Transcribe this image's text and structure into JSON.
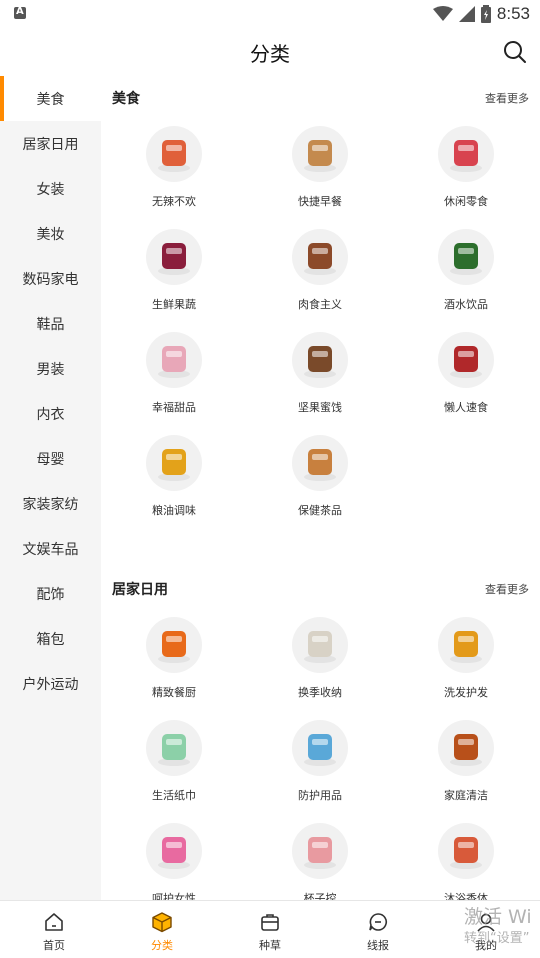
{
  "status_bar": {
    "time": "8:53"
  },
  "header": {
    "title": "分类"
  },
  "sidebar": {
    "items": [
      {
        "label": "美食",
        "active": true
      },
      {
        "label": "居家日用"
      },
      {
        "label": "女装"
      },
      {
        "label": "美妆"
      },
      {
        "label": "数码家电"
      },
      {
        "label": "鞋品"
      },
      {
        "label": "男装"
      },
      {
        "label": "内衣"
      },
      {
        "label": "母婴"
      },
      {
        "label": "家装家纺"
      },
      {
        "label": "文娱车品"
      },
      {
        "label": "配饰"
      },
      {
        "label": "箱包"
      },
      {
        "label": "户外运动"
      }
    ]
  },
  "sections": [
    {
      "title": "美食",
      "more": "查看更多",
      "items": [
        {
          "label": "无辣不欢",
          "icon": "spicy-food-icon",
          "color": "#e0603a"
        },
        {
          "label": "快捷早餐",
          "icon": "bread-icon",
          "color": "#c48a4e"
        },
        {
          "label": "休闲零食",
          "icon": "snack-bag-icon",
          "color": "#d8434f"
        },
        {
          "label": "生鲜果蔬",
          "icon": "berries-icon",
          "color": "#8a1e3c"
        },
        {
          "label": "肉食主义",
          "icon": "meat-icon",
          "color": "#8c4a2a"
        },
        {
          "label": "酒水饮品",
          "icon": "bottles-icon",
          "color": "#2c6e2c"
        },
        {
          "label": "幸福甜品",
          "icon": "macaron-icon",
          "color": "#e8a7b8"
        },
        {
          "label": "坚果蜜饯",
          "icon": "nuts-icon",
          "color": "#7a4a2a"
        },
        {
          "label": "懒人速食",
          "icon": "instant-noodle-icon",
          "color": "#b0282a"
        },
        {
          "label": "粮油调味",
          "icon": "oil-bottle-icon",
          "color": "#e3a21a"
        },
        {
          "label": "保健茶品",
          "icon": "tea-box-icon",
          "color": "#c8803e"
        }
      ]
    },
    {
      "title": "居家日用",
      "more": "查看更多",
      "items": [
        {
          "label": "精致餐厨",
          "icon": "cooking-pot-icon",
          "color": "#e86a1a"
        },
        {
          "label": "换季收纳",
          "icon": "storage-box-icon",
          "color": "#d8d2c6"
        },
        {
          "label": "洗发护发",
          "icon": "shampoo-icon",
          "color": "#e39a1a"
        },
        {
          "label": "生活纸巾",
          "icon": "tissue-icon",
          "color": "#8cd0a8"
        },
        {
          "label": "防护用品",
          "icon": "mask-icon",
          "color": "#5aa8d8"
        },
        {
          "label": "家庭清洁",
          "icon": "disinfectant-icon",
          "color": "#b8501a"
        },
        {
          "label": "呵护女性",
          "icon": "pad-icon",
          "color": "#e86aa0"
        },
        {
          "label": "杯子控",
          "icon": "cup-icon",
          "color": "#e89aa0"
        },
        {
          "label": "沐浴香体",
          "icon": "body-wash-icon",
          "color": "#d85a3a"
        }
      ]
    }
  ],
  "bottom_nav": [
    {
      "label": "首页",
      "icon": "home-icon"
    },
    {
      "label": "分类",
      "icon": "category-box-icon",
      "active": true
    },
    {
      "label": "种草",
      "icon": "bag-icon"
    },
    {
      "label": "线报",
      "icon": "message-icon"
    },
    {
      "label": "我的",
      "icon": "user-icon"
    }
  ],
  "watermark": {
    "line1": "激活 Wi",
    "line2": "转到“设置”"
  },
  "colors": {
    "accent": "#ff8a00",
    "sidebar_bg": "#f5f5f5",
    "thumb_bg": "#f1f1f1"
  }
}
